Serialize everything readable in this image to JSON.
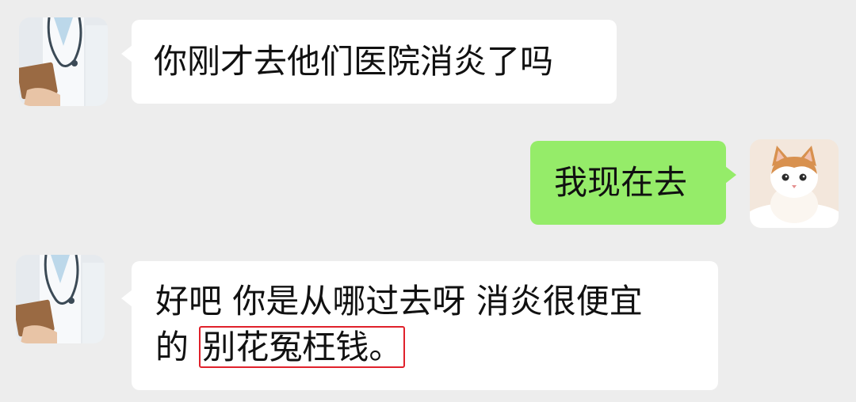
{
  "messages": [
    {
      "direction": "incoming",
      "avatar": "doctor-avatar",
      "text": "你刚才去他们医院消炎了吗"
    },
    {
      "direction": "outgoing",
      "avatar": "kitten-avatar",
      "text": "我现在去"
    },
    {
      "direction": "incoming",
      "avatar": "doctor-avatar",
      "line1": "好吧 你是从哪过去呀  消炎很便宜",
      "line2_prefix": "的 ",
      "line2_highlight": "别花冤枉钱。"
    }
  ],
  "colors": {
    "background": "#ededed",
    "incoming_bubble": "#ffffff",
    "outgoing_bubble": "#95ec69",
    "highlight_box": "#e0212b"
  }
}
